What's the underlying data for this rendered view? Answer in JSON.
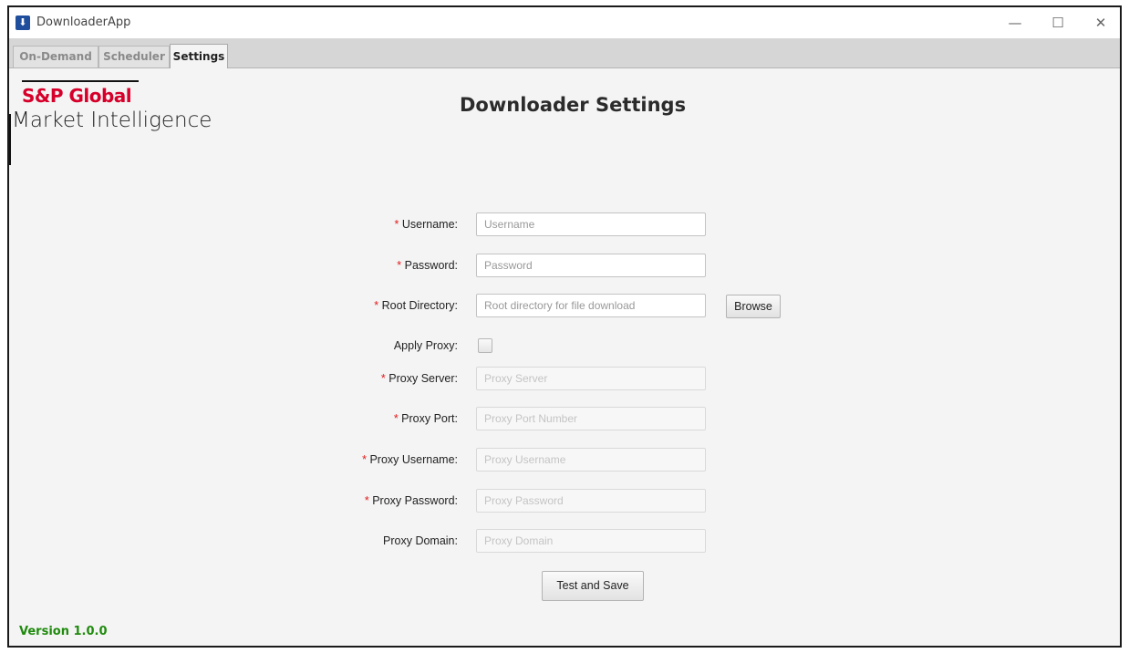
{
  "window": {
    "title": "DownloaderApp",
    "minimize": "—",
    "maximize": "☐",
    "close": "✕"
  },
  "tabs": [
    {
      "label": "On-Demand",
      "active": false
    },
    {
      "label": "Scheduler",
      "active": false
    },
    {
      "label": "Settings",
      "active": true
    }
  ],
  "logo": {
    "line1": "S&P Global",
    "line2": "Market Intelligence",
    "brand_color": "#d6002a"
  },
  "page_title": "Downloader  Settings",
  "form": {
    "required_mark": "*",
    "username": {
      "label": "Username:",
      "placeholder": "Username",
      "value": ""
    },
    "password": {
      "label": "Password:",
      "placeholder": "Password",
      "value": ""
    },
    "root_directory": {
      "label": "Root Directory:",
      "placeholder": "Root directory for file download",
      "value": "",
      "browse_label": "Browse"
    },
    "apply_proxy": {
      "label": "Apply Proxy:",
      "checked": false
    },
    "proxy_server": {
      "label": "Proxy Server:",
      "placeholder": "Proxy Server",
      "disabled": true
    },
    "proxy_port": {
      "label": "Proxy Port:",
      "placeholder": "Proxy Port Number",
      "disabled": true
    },
    "proxy_username": {
      "label": "Proxy Username:",
      "placeholder": "Proxy Username",
      "disabled": true
    },
    "proxy_password": {
      "label": "Proxy Password:",
      "placeholder": "Proxy Password",
      "disabled": true
    },
    "proxy_domain": {
      "label": "Proxy Domain:",
      "placeholder": "Proxy Domain",
      "disabled": true
    },
    "submit_label": "Test and Save"
  },
  "version": "Version 1.0.0",
  "colors": {
    "required": "#e01b1b",
    "version": "#1f8a0d"
  }
}
